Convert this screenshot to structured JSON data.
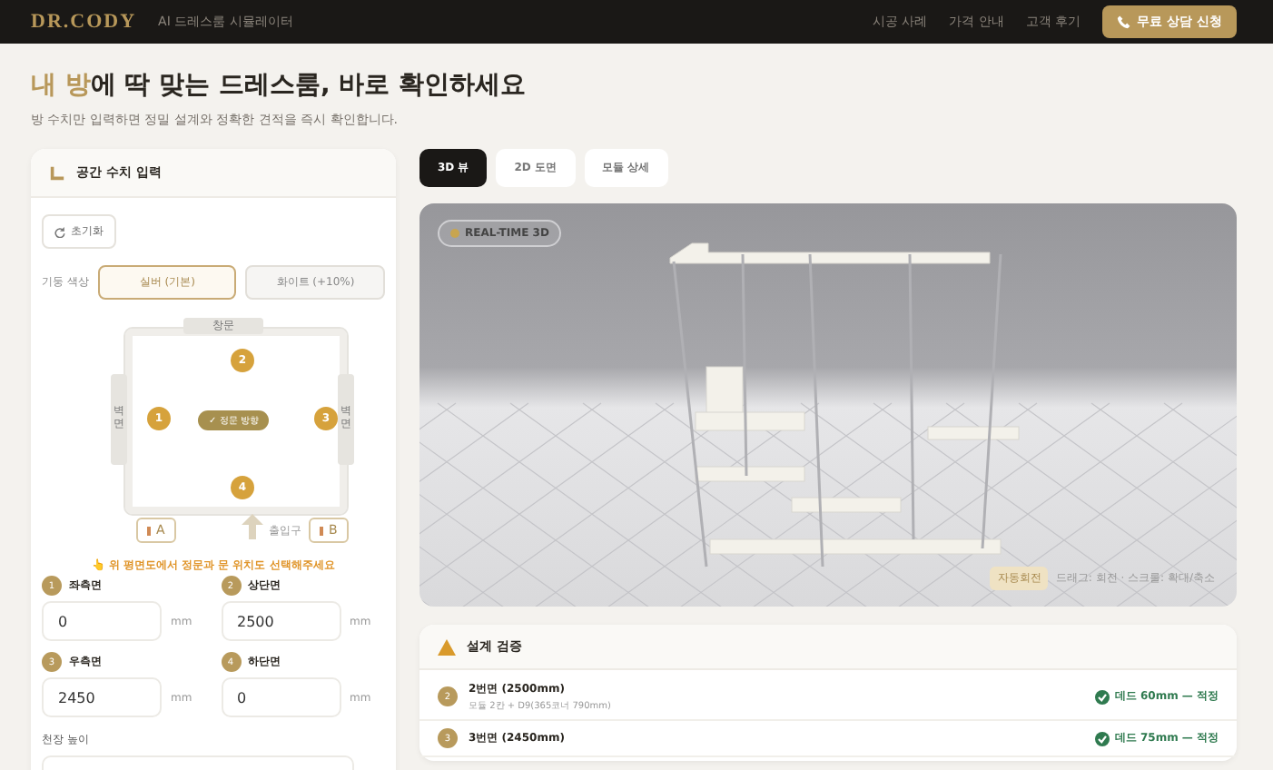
{
  "header": {
    "logo": "DR.CODY",
    "tagline": "AI 드레스룸 시뮬레이터",
    "nav": [
      "시공 사례",
      "가격 안내",
      "고객 후기"
    ],
    "cta": "무료 상담 신청"
  },
  "hero": {
    "title": "**내 방**에 딱 맞는 드레스룸, 바로 확인하세요",
    "subtitle": "방 수치만 입력하면 정밀 설계와 정확한 견적을 즉시 확인합니다."
  },
  "input_panel": {
    "title": "공간 수치 입력",
    "reset": "초기화",
    "color_label": "기둥 색상",
    "color_options": [
      {
        "label": "실버 (기본)",
        "selected": true
      },
      {
        "label": "화이트 (+10%)",
        "selected": false
      }
    ],
    "plan": {
      "window": "창문",
      "side_left": "벽면",
      "side_right": "벽면",
      "center": "✓ 정문 방향",
      "markers": [
        "1",
        "2",
        "3",
        "4"
      ],
      "door_a": "A",
      "door_b": "B",
      "entrance": "출입구"
    },
    "hint": "👆 위 평면도에서 정문과 문 위치도 선택해주세요",
    "fields": [
      {
        "number": "1",
        "label": "좌측면",
        "value": "0",
        "unit": "mm"
      },
      {
        "number": "2",
        "label": "상단면",
        "value": "2500",
        "unit": "mm"
      },
      {
        "number": "3",
        "label": "우측면",
        "value": "2450",
        "unit": "mm"
      },
      {
        "number": "4",
        "label": "하단면",
        "value": "0",
        "unit": "mm"
      }
    ],
    "ceiling_label": "천장 높이"
  },
  "view_tabs": [
    {
      "label": "3D 뷰",
      "selected": true
    },
    {
      "label": "2D 도면",
      "selected": false
    },
    {
      "label": "모듈 상세",
      "selected": false
    }
  ],
  "viewer": {
    "badge": "REAL-TIME 3D",
    "autorotate": {
      "label": "자동회전",
      "on": true
    },
    "help": "드래그: 회전 · 스크롤: 확대/축소"
  },
  "validation": {
    "title": "설계 검증",
    "rows": [
      {
        "number": "2",
        "title": "2번면 (2500mm)",
        "detail": "모듈 2칸 + D9(365코너 790mm)",
        "status": "데드 60mm — 적정",
        "kind": "ok"
      },
      {
        "number": "3",
        "title": "3번면 (2450mm)",
        "status": "데드 75mm — 적정",
        "kind": "ok"
      }
    ]
  }
}
